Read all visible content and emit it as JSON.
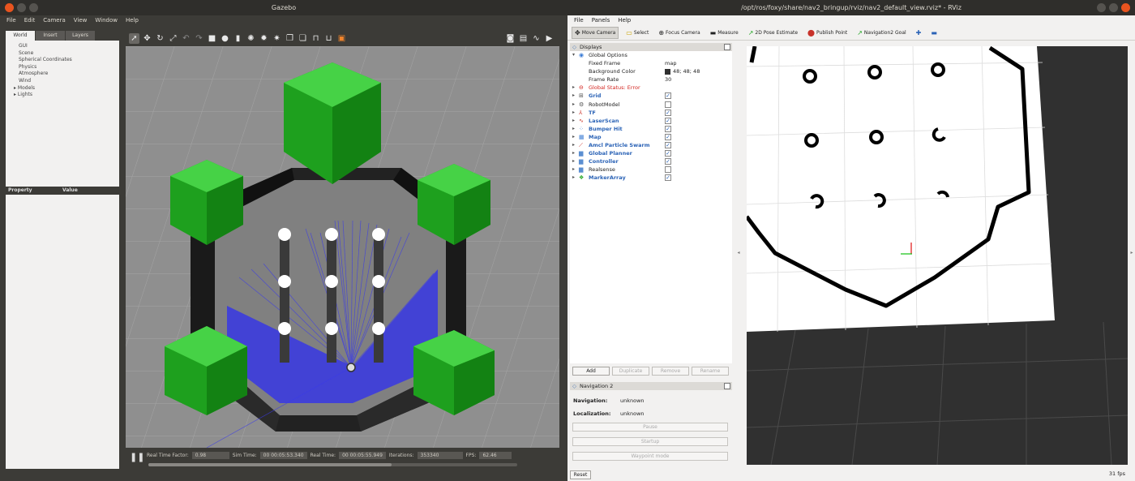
{
  "gazebo": {
    "title": "Gazebo",
    "menu": [
      "File",
      "Edit",
      "Camera",
      "View",
      "Window",
      "Help"
    ],
    "tabs": [
      "World",
      "Insert",
      "Layers"
    ],
    "tree": [
      {
        "label": "GUI",
        "expand": false
      },
      {
        "label": "Scene",
        "expand": false
      },
      {
        "label": "Spherical Coordinates",
        "expand": false
      },
      {
        "label": "Physics",
        "expand": false
      },
      {
        "label": "Atmosphere",
        "expand": false
      },
      {
        "label": "Wind",
        "expand": false
      },
      {
        "label": "Models",
        "expand": true
      },
      {
        "label": "Lights",
        "expand": true
      }
    ],
    "property_header": {
      "property": "Property",
      "value": "Value"
    },
    "status": {
      "rtf_label": "Real Time Factor:",
      "rtf": "0.98",
      "sim_label": "Sim Time:",
      "sim": "00 00:05:53.340",
      "real_label": "Real Time:",
      "real": "00 00:05:55.949",
      "iter_label": "Iterations:",
      "iter": "353340",
      "fps_label": "FPS:",
      "fps": "62.46"
    }
  },
  "rviz": {
    "title": "/opt/ros/foxy/share/nav2_bringup/rviz/nav2_default_view.rviz* - RViz",
    "menu": [
      "File",
      "Panels",
      "Help"
    ],
    "tools": [
      "Move Camera",
      "Select",
      "Focus Camera",
      "Measure",
      "2D Pose Estimate",
      "Publish Point",
      "Navigation2 Goal"
    ],
    "displays_title": "Displays",
    "displays": [
      {
        "label": "Global Options",
        "kind": "group",
        "icon": "globe-icon",
        "arrow": "▾"
      },
      {
        "label": "Fixed Frame",
        "kind": "prop",
        "value": "map"
      },
      {
        "label": "Background Color",
        "kind": "prop",
        "value": "48; 48; 48"
      },
      {
        "label": "Frame Rate",
        "kind": "prop",
        "value": "30"
      },
      {
        "label": "Global Status: Error",
        "kind": "error",
        "icon": "error-icon",
        "arrow": "▸"
      },
      {
        "label": "Grid",
        "kind": "display",
        "checked": true,
        "icon": "grid-icon",
        "arrow": "▸"
      },
      {
        "label": "RobotModel",
        "kind": "display-plain",
        "checked": false,
        "icon": "robot-icon",
        "arrow": "▸"
      },
      {
        "label": "TF",
        "kind": "display",
        "checked": true,
        "icon": "tf-icon",
        "arrow": "▸"
      },
      {
        "label": "LaserScan",
        "kind": "display",
        "checked": true,
        "icon": "laser-icon",
        "arrow": "▸"
      },
      {
        "label": "Bumper Hit",
        "kind": "display",
        "checked": true,
        "icon": "bumper-icon",
        "arrow": "▸"
      },
      {
        "label": "Map",
        "kind": "display",
        "checked": true,
        "icon": "map-icon",
        "arrow": "▸"
      },
      {
        "label": "Amcl Particle Swarm",
        "kind": "display",
        "checked": true,
        "icon": "swarm-icon",
        "arrow": "▸"
      },
      {
        "label": "Global Planner",
        "kind": "display",
        "checked": true,
        "icon": "folder-icon",
        "arrow": "▸"
      },
      {
        "label": "Controller",
        "kind": "display",
        "checked": true,
        "icon": "folder-icon",
        "arrow": "▸"
      },
      {
        "label": "Realsense",
        "kind": "display-plain",
        "checked": false,
        "icon": "folder-icon",
        "arrow": "▸"
      },
      {
        "label": "MarkerArray",
        "kind": "display",
        "checked": true,
        "icon": "marker-icon",
        "arrow": "▸"
      }
    ],
    "display_buttons": [
      "Add",
      "Duplicate",
      "Remove",
      "Rename"
    ],
    "nav2": {
      "title": "Navigation 2",
      "navigation_label": "Navigation:",
      "navigation": "unknown",
      "localization_label": "Localization:",
      "localization": "unknown",
      "buttons": [
        "Pause",
        "Startup",
        "Waypoint mode"
      ]
    },
    "reset": "Reset",
    "fps": "31 fps"
  }
}
